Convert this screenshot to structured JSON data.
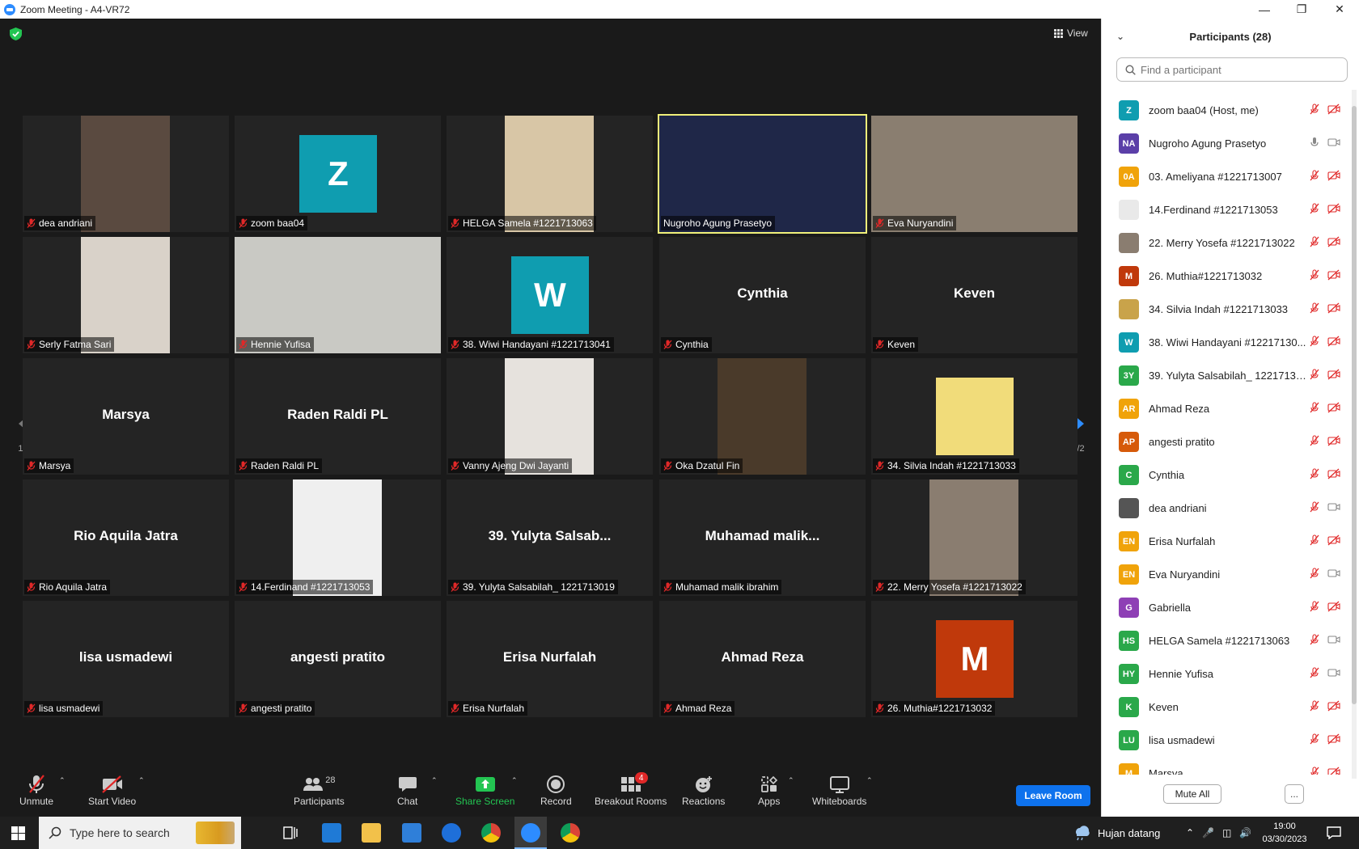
{
  "window": {
    "title": "Zoom Meeting - A4-VR72"
  },
  "meeting": {
    "view_label": "View",
    "page_indicator_left": "1/2",
    "page_indicator_right": "1/2",
    "tiles": [
      {
        "display_name": "",
        "label": "dea andriani",
        "type": "photo",
        "photo_color": "#5a4a40",
        "muted": true
      },
      {
        "display_name": "",
        "label": "zoom baa04",
        "type": "avatar",
        "avatar_letter": "Z",
        "avatar_color": "#0f9db0",
        "muted": true
      },
      {
        "display_name": "",
        "label": "HELGA Samela #1221713063",
        "type": "photo",
        "photo_color": "#d8c6a6",
        "muted": true
      },
      {
        "display_name": "",
        "label": "Nugroho Agung Prasetyo",
        "type": "video",
        "photo_color": "#1f2748",
        "muted": false,
        "active": true
      },
      {
        "display_name": "",
        "label": "Eva Nuryandini",
        "type": "video",
        "photo_color": "#8a7e70",
        "muted": true
      },
      {
        "display_name": "",
        "label": "Serly Fatma Sari",
        "type": "photo",
        "photo_color": "#d9d2c9",
        "muted": true
      },
      {
        "display_name": "",
        "label": "Hennie Yufisa",
        "type": "video",
        "photo_color": "#c9c9c4",
        "muted": true
      },
      {
        "display_name": "",
        "label": "38. Wiwi Handayani #1221713041",
        "type": "avatar",
        "avatar_letter": "W",
        "avatar_color": "#0f9db0",
        "muted": true
      },
      {
        "display_name": "Cynthia",
        "label": "Cynthia",
        "type": "name",
        "muted": true
      },
      {
        "display_name": "Keven",
        "label": "Keven",
        "type": "name",
        "muted": true
      },
      {
        "display_name": "Marsya",
        "label": "Marsya",
        "type": "name",
        "muted": true
      },
      {
        "display_name": "Raden Raldi PL",
        "label": "Raden Raldi PL",
        "type": "name",
        "muted": true
      },
      {
        "display_name": "",
        "label": "Vanny Ajeng Dwi Jayanti",
        "type": "photo",
        "photo_color": "#e6e2dd",
        "muted": true
      },
      {
        "display_name": "",
        "label": "Oka Dzatul Fin",
        "type": "photo",
        "photo_color": "#4a3a2a",
        "muted": true
      },
      {
        "display_name": "",
        "label": "34. Silvia Indah #1221713033",
        "type": "avatar",
        "avatar_letter": "",
        "avatar_color": "#f1dc7a",
        "muted": true
      },
      {
        "display_name": "Rio Aquila Jatra",
        "label": "Rio Aquila Jatra",
        "type": "name",
        "muted": true
      },
      {
        "display_name": "",
        "label": "14.Ferdinand #1221713053",
        "type": "photo",
        "photo_color": "#efefef",
        "muted": true
      },
      {
        "display_name": "39. Yulyta Salsab...",
        "label": "39. Yulyta Salsabilah_ 1221713019",
        "type": "name",
        "muted": true
      },
      {
        "display_name": "Muhamad  malik...",
        "label": "Muhamad malik ibrahim",
        "type": "name",
        "muted": true
      },
      {
        "display_name": "",
        "label": "22. Merry Yosefa #1221713022",
        "type": "photo",
        "photo_color": "#8a7d70",
        "muted": true
      },
      {
        "display_name": "lisa usmadewi",
        "label": "lisa usmadewi",
        "type": "name",
        "muted": true
      },
      {
        "display_name": "angesti pratito",
        "label": "angesti pratito",
        "type": "name",
        "muted": true
      },
      {
        "display_name": "Erisa Nurfalah",
        "label": "Erisa Nurfalah",
        "type": "name",
        "muted": true
      },
      {
        "display_name": "Ahmad Reza",
        "label": "Ahmad Reza",
        "type": "name",
        "muted": true
      },
      {
        "display_name": "",
        "label": "26. Muthia#1221713032",
        "type": "avatar",
        "avatar_letter": "M",
        "avatar_color": "#c0390b",
        "muted": true
      }
    ]
  },
  "toolbar": {
    "unmute": "Unmute",
    "start_video": "Start Video",
    "participants": "Participants",
    "participants_count": "28",
    "chat": "Chat",
    "share_screen": "Share Screen",
    "record": "Record",
    "breakout_rooms": "Breakout Rooms",
    "breakout_badge": "4",
    "reactions": "Reactions",
    "apps": "Apps",
    "whiteboards": "Whiteboards",
    "leave_room": "Leave Room"
  },
  "panel": {
    "title": "Participants (28)",
    "search_placeholder": "Find a participant",
    "mute_all": "Mute All",
    "more": "...",
    "participants": [
      {
        "name": "zoom baa04 (Host, me)",
        "initials": "Z",
        "color": "#0f9db0",
        "mic": "muted",
        "video": "off"
      },
      {
        "name": "Nugroho Agung Prasetyo",
        "initials": "NA",
        "color": "#5b3fa8",
        "mic": "on",
        "video": "on"
      },
      {
        "name": "03. Ameliyana #1221713007",
        "initials": "0A",
        "color": "#f0a30a",
        "mic": "muted",
        "video": "off"
      },
      {
        "name": "14.Ferdinand #1221713053",
        "initials": "",
        "color": "#e9e9e9",
        "mic": "muted",
        "video": "off"
      },
      {
        "name": "22. Merry Yosefa #1221713022",
        "initials": "",
        "color": "#8a7d70",
        "mic": "muted",
        "video": "off"
      },
      {
        "name": "26. Muthia#1221713032",
        "initials": "M",
        "color": "#c0390b",
        "mic": "muted",
        "video": "off"
      },
      {
        "name": "34. Silvia Indah #1221713033",
        "initials": "",
        "color": "#c9a34a",
        "mic": "muted",
        "video": "off"
      },
      {
        "name": "38. Wiwi Handayani #12217130...",
        "initials": "W",
        "color": "#0f9db0",
        "mic": "muted",
        "video": "off"
      },
      {
        "name": "39. Yulyta Salsabilah_ 12217130...",
        "initials": "3Y",
        "color": "#2aa84a",
        "mic": "muted",
        "video": "off"
      },
      {
        "name": "Ahmad Reza",
        "initials": "AR",
        "color": "#f0a30a",
        "mic": "muted",
        "video": "off"
      },
      {
        "name": "angesti pratito",
        "initials": "AP",
        "color": "#d65a0a",
        "mic": "muted",
        "video": "off"
      },
      {
        "name": "Cynthia",
        "initials": "C",
        "color": "#2aa84a",
        "mic": "muted",
        "video": "off"
      },
      {
        "name": "dea andriani",
        "initials": "",
        "color": "#555555",
        "mic": "muted",
        "video": "on"
      },
      {
        "name": "Erisa Nurfalah",
        "initials": "EN",
        "color": "#f0a30a",
        "mic": "muted",
        "video": "off"
      },
      {
        "name": "Eva Nuryandini",
        "initials": "EN",
        "color": "#f0a30a",
        "mic": "muted",
        "video": "on"
      },
      {
        "name": "Gabriella",
        "initials": "G",
        "color": "#8e3fb5",
        "mic": "muted",
        "video": "off"
      },
      {
        "name": "HELGA Samela #1221713063",
        "initials": "HS",
        "color": "#2aa84a",
        "mic": "muted",
        "video": "on"
      },
      {
        "name": "Hennie Yufisa",
        "initials": "HY",
        "color": "#2aa84a",
        "mic": "muted",
        "video": "on"
      },
      {
        "name": "Keven",
        "initials": "K",
        "color": "#2aa84a",
        "mic": "muted",
        "video": "off"
      },
      {
        "name": "lisa usmadewi",
        "initials": "LU",
        "color": "#2aa84a",
        "mic": "muted",
        "video": "off"
      },
      {
        "name": "Marsya",
        "initials": "M",
        "color": "#f0a30a",
        "mic": "muted",
        "video": "off"
      }
    ]
  },
  "taskbar": {
    "search_placeholder": "Type here to search",
    "weather": "Hujan datang",
    "time": "19:00",
    "date": "03/30/2023"
  }
}
